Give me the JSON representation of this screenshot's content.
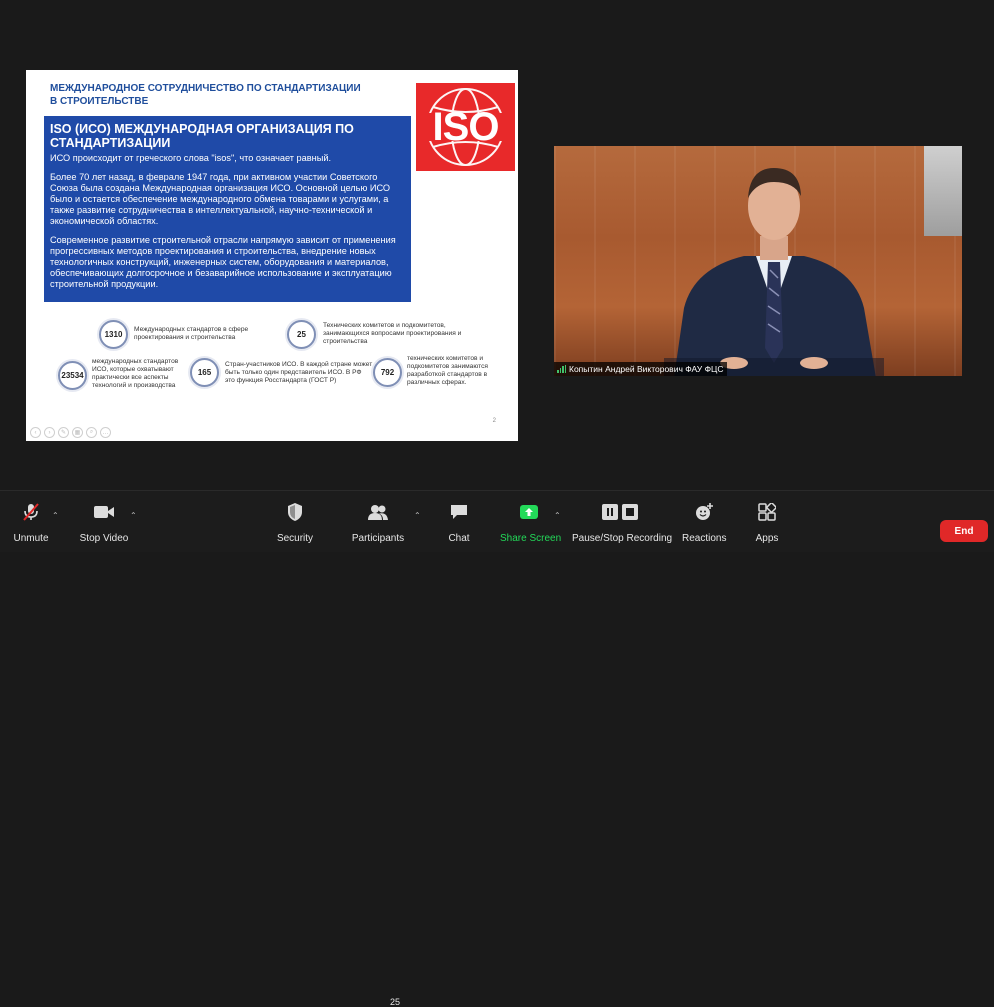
{
  "slide": {
    "header": "МЕЖДУНАРОДНОЕ СОТРУДНИЧЕСТВО ПО СТАНДАРТИЗАЦИИ В СТРОИТЕЛЬСТВЕ",
    "logo_text": "ISO",
    "box_title": "ISO (ИСО) МЕЖДУНАРОДНАЯ ОРГАНИЗАЦИЯ ПО СТАНДАРТИЗАЦИИ",
    "box_p1": "ИСО происходит от греческого слова \"isos\", что означает равный.",
    "box_p2": "Более 70 лет назад, в феврале 1947 года, при активном участии Советского Союза была создана Международная организация ИСО. Основной целью ИСО было и остается обеспечение международного обмена товарами и услугами, а также развитие сотрудничества в интеллектуальной, научно-технической и экономической областях.",
    "box_p3": "Современное развитие строительной отрасли напрямую зависит от применения прогрессивных методов проектирования и строительства, внедрение новых технологичных конструкций, инженерных систем, оборудования и материалов, обеспечивающих долгосрочное и безаварийное использование и эксплуатацию строительной продукции.",
    "stats": [
      {
        "value": "1310",
        "text": "Международных стандартов в сфере проектирования и строительства"
      },
      {
        "value": "25",
        "text": "Технических комитетов и подкомитетов, занимающихся вопросами проектирования и строительства"
      },
      {
        "value": "23534",
        "text": "международных стандартов ИСО, которые охватывают практически все аспекты технологий и производства"
      },
      {
        "value": "165",
        "text": "Стран-участников ИСО. В каждой стране может быть только один представитель ИСО. В РФ это функция Росстандарта (ГОСТ Р)"
      },
      {
        "value": "792",
        "text": "технических комитетов и подкомитетов занимаются разработкой стандартов в различных сферах."
      }
    ],
    "page_number": "2"
  },
  "video": {
    "participant_name": "Копытин Андрей Викторович ФАУ ФЦС"
  },
  "toolbar": {
    "unmute": "Unmute",
    "stop_video": "Stop Video",
    "security": "Security",
    "participants": "Participants",
    "participants_count": "25",
    "chat": "Chat",
    "share_screen": "Share Screen",
    "recording": "Pause/Stop Recording",
    "reactions": "Reactions",
    "apps": "Apps",
    "end": "End"
  },
  "colors": {
    "share_green": "#23d959",
    "end_red": "#e02828",
    "slide_blue": "#1f4aa8",
    "iso_red": "#e8292a"
  }
}
